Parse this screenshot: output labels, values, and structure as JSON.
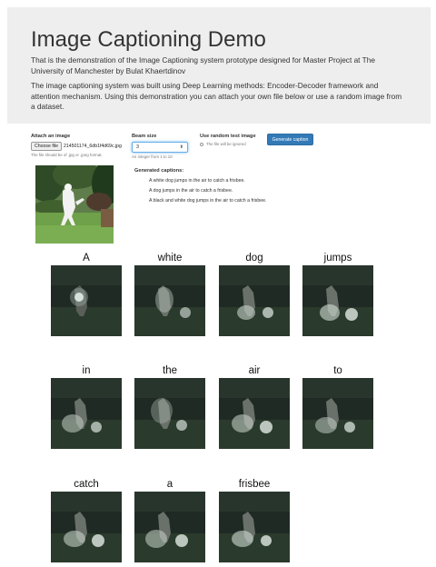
{
  "header": {
    "title": "Image Captioning Demo",
    "intro": "That is the demonstration of the Image Captioning system prototype designed for Master Project at The University of Manchester by Bulat Khaertdinov",
    "description": "The image captioning system was built using Deep Learning methods: Encoder-Decoder framework and attention mechanism. Using this demonstration you can attach your own file below or use a random image from a dataset."
  },
  "form": {
    "attach_label": "Attach an image",
    "choose_file_label": "Choose file",
    "file_name": "214501174_6db1f4d69c.jpg",
    "file_help": "The file should be of .jpg or .jpeg format.",
    "beam_label": "Beam size",
    "beam_value": "3",
    "beam_help": "An integer from 1 to 10",
    "random_label": "Use random test image",
    "random_help": "The file will be ignored",
    "generate_label": "Generate caption"
  },
  "captions": {
    "heading": "Generated captions:",
    "items": [
      "A white dog jumps in the air to catch a frisbee.",
      "A dog jumps in the air to catch a frisbee.",
      "A black and white dog jumps in the air to catch a frisbee."
    ]
  },
  "attention": {
    "words": [
      "A",
      "white",
      "dog",
      "jumps",
      "in",
      "the",
      "air",
      "to",
      "catch",
      "a",
      "frisbee"
    ]
  }
}
